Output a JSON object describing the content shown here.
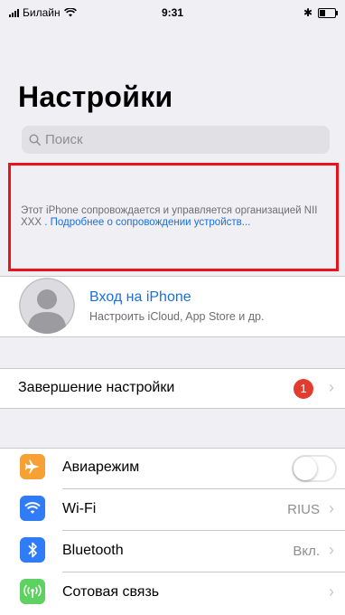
{
  "status_bar": {
    "carrier": "Билайн",
    "time": "9:31",
    "bluetooth_symbol": "✱",
    "battery_level": 0.4
  },
  "page_title": "Настройки",
  "search": {
    "placeholder": "Поиск"
  },
  "notice": {
    "text": "Этот iPhone сопровождается и управляется организацией NII XXX",
    "link": ". Подробнее о сопровождении устройств..."
  },
  "profile": {
    "title": "Вход на iPhone",
    "subtitle": "Настроить iCloud, App Store и др."
  },
  "finish_setup": {
    "label": "Завершение настройки",
    "badge": "1"
  },
  "settings": {
    "airplane": {
      "label": "Авиарежим",
      "enabled": false,
      "color": "#f7a033"
    },
    "wifi": {
      "label": "Wi-Fi",
      "value": "RIUS",
      "color": "#2f7cf6"
    },
    "bluetooth": {
      "label": "Bluetooth",
      "value": "Вкл.",
      "color": "#2f7cf6"
    },
    "cellular": {
      "label": "Сотовая связь",
      "color": "#5dd161"
    }
  },
  "colors": {
    "accent": "#1a6fdc",
    "notice_border": "#e8141a",
    "badge": "#e33c2e"
  }
}
